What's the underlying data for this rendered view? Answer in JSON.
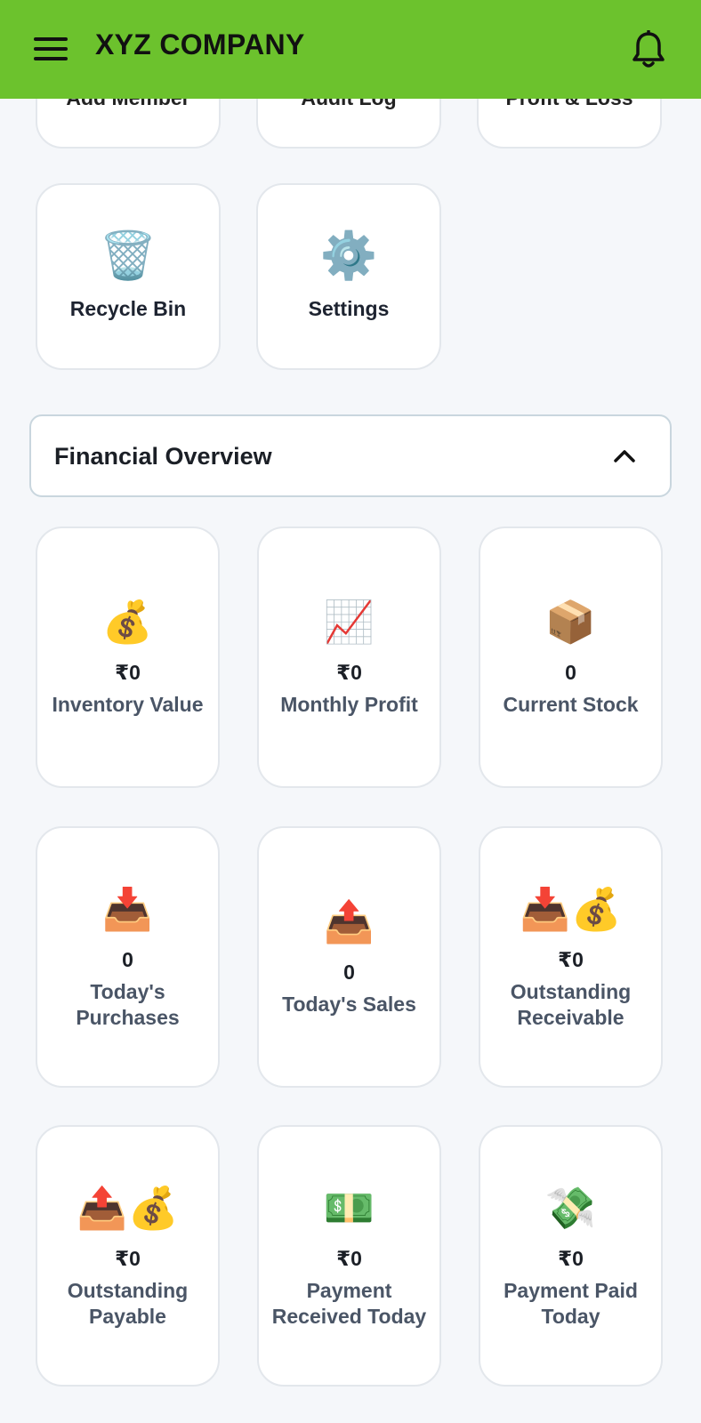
{
  "header": {
    "title": "XYZ COMPANY",
    "background": "#6cc22d"
  },
  "top_row_cut": [
    {
      "label": "Add Member"
    },
    {
      "label": "Audit Log"
    },
    {
      "label": "Profit & Loss"
    }
  ],
  "tiles": [
    {
      "label": "Recycle Bin",
      "icon": "🗑️",
      "icon_name": "trash-icon"
    },
    {
      "label": "Settings",
      "icon": "⚙️",
      "icon_name": "gear-icon"
    }
  ],
  "financial": {
    "title": "Financial Overview",
    "expanded": true,
    "cards": [
      {
        "icon": "💰",
        "icon_name": "money-bag-icon",
        "value": "₹0",
        "label": "Inventory Value"
      },
      {
        "icon": "📈",
        "icon_name": "chart-increasing-icon",
        "value": "₹0",
        "label": "Monthly Profit"
      },
      {
        "icon": "📦",
        "icon_name": "package-icon",
        "value": "0",
        "label": "Current Stock"
      },
      {
        "icon": "📥",
        "icon_name": "inbox-tray-icon",
        "value": "0",
        "label": "Today's Purchases"
      },
      {
        "icon": "📤",
        "icon_name": "outbox-tray-icon",
        "value": "0",
        "label": "Today's Sales"
      },
      {
        "icon": "📥💰",
        "icon_name": "inbox-money-icon",
        "value": "₹0",
        "label": "Outstanding Receivable"
      },
      {
        "icon": "📤💰",
        "icon_name": "outbox-money-icon",
        "value": "₹0",
        "label": "Outstanding Payable"
      },
      {
        "icon": "💵",
        "icon_name": "dollar-banknote-icon",
        "value": "₹0",
        "label": "Payment Received Today"
      },
      {
        "icon": "💸",
        "icon_name": "money-with-wings-icon",
        "value": "₹0",
        "label": "Payment Paid Today"
      }
    ]
  }
}
